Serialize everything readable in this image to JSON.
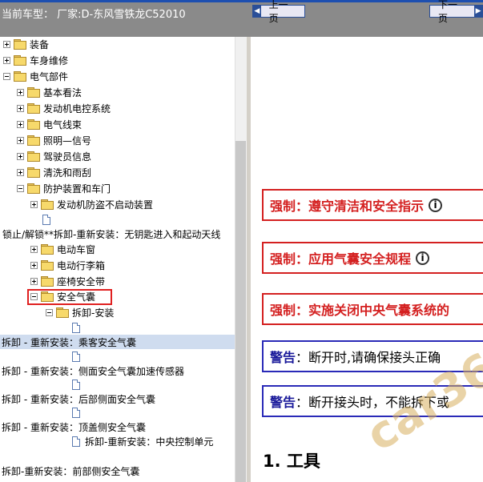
{
  "header": {
    "title": "当前车型： 厂家:D-东风雪铁龙C52010"
  },
  "nav": {
    "prev_label": "上一页",
    "next_label": "下一页"
  },
  "tree": [
    {
      "label": "装备"
    },
    {
      "label": "车身维修"
    },
    {
      "label": "电气部件"
    },
    {
      "label": "基本看法"
    },
    {
      "label": "发动机电控系统"
    },
    {
      "label": "电气线束"
    },
    {
      "label": "照明—信号"
    },
    {
      "label": "驾驶员信息"
    },
    {
      "label": "清洗和雨刮"
    },
    {
      "label": "防护装置和车门"
    },
    {
      "label": "发动机防盗不启动装置"
    },
    {
      "label": ""
    },
    {
      "label": "锁止/解锁**拆卸-重新安装：无钥匙进入和起动天线"
    },
    {
      "label": "电动车窗"
    },
    {
      "label": "电动行李箱"
    },
    {
      "label": "座椅安全带"
    },
    {
      "label": "安全气囊"
    },
    {
      "label": "拆卸-安装"
    },
    {
      "label": ""
    },
    {
      "label": "拆卸 - 重新安装：乘客安全气囊"
    },
    {
      "label": ""
    },
    {
      "label": "拆卸 - 重新安装：侧面安全气囊加速传感器"
    },
    {
      "label": ""
    },
    {
      "label": "拆卸 - 重新安装：后部侧面安全气囊"
    },
    {
      "label": ""
    },
    {
      "label": "拆卸 - 重新安装：顶盖侧安全气囊"
    },
    {
      "label": "拆卸-重新安装：中央控制单元"
    },
    {
      "label": "拆卸-重新安装：前部侧安全气囊"
    }
  ],
  "content": {
    "notices": [
      {
        "keyword": "强制",
        "text": "：遵守清洁和安全指示"
      },
      {
        "keyword": "强制",
        "text": "：应用气囊安全规程"
      },
      {
        "keyword": "强制",
        "text": "：实施关闭中央气囊系统的"
      },
      {
        "keyword": "警告",
        "text": "：断开时,请确保接头正确"
      },
      {
        "keyword": "警告",
        "text": "：断开接头时，不能拆下或"
      }
    ],
    "info_glyph": "i",
    "section_heading": "1. 工具",
    "watermark": "car36"
  },
  "colors": {
    "mandatory": "#d42020",
    "warning": "#2a2ab8",
    "titlebar": "#8a8a8a",
    "selection": "#cfdcef"
  }
}
